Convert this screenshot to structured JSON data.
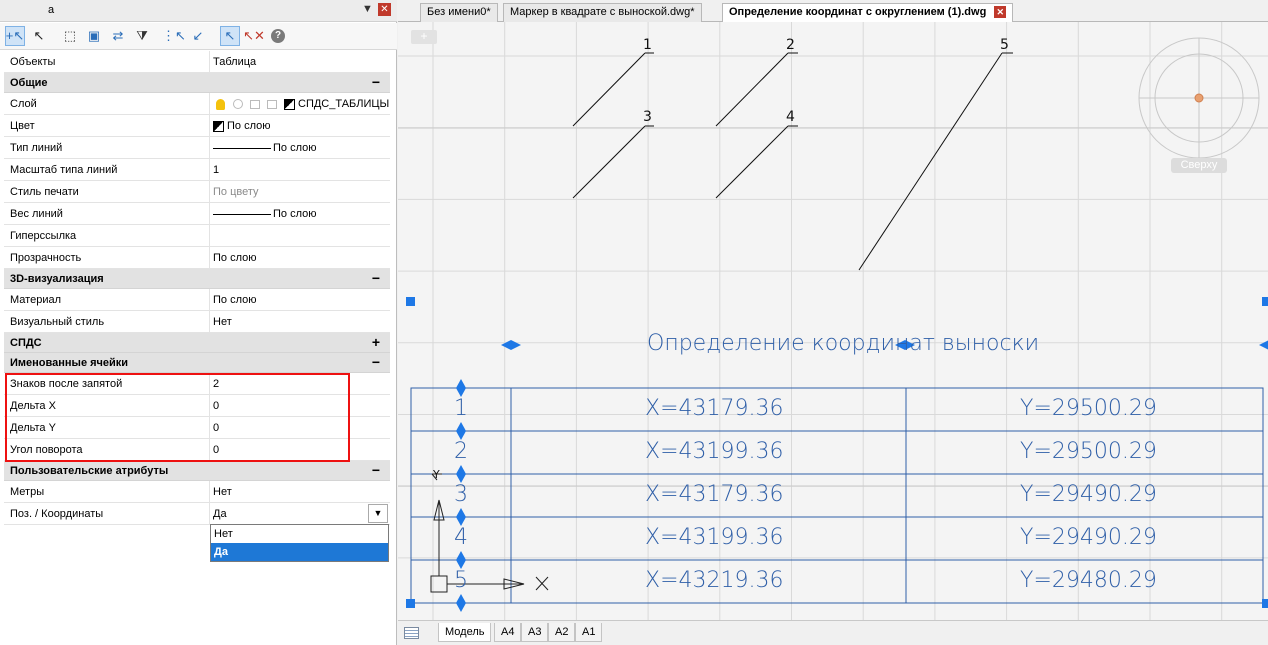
{
  "panel": {
    "title": "a",
    "pin_glyph": "▼",
    "close_glyph": "✕",
    "toolbar": [
      "select-add-icon",
      "pointer-icon",
      "window-select-icon",
      "quick-select-icon",
      "toggle-pickadd-icon",
      "filter-icon",
      "select-similar-icon",
      "deselect-icon",
      "pick-point-icon",
      "deselect-point-icon",
      "help-icon"
    ],
    "help_label": "?",
    "rows": {
      "objects": {
        "k": "Объекты",
        "v": "Таблица"
      },
      "cat_general": {
        "k": "Общие",
        "toggle": "−"
      },
      "layer": {
        "k": "Слой",
        "v": "СПДС_ТАБЛИЦЫ"
      },
      "color": {
        "k": "Цвет",
        "v": "По слою"
      },
      "linetype": {
        "k": "Тип линий",
        "v": "По слою"
      },
      "lt_scale": {
        "k": "Масштаб типа линий",
        "v": "1"
      },
      "plot_style": {
        "k": "Стиль печати",
        "v": "По цвету"
      },
      "lineweight": {
        "k": "Вес линий",
        "v": "По слою"
      },
      "hyperlink": {
        "k": "Гиперссылка",
        "v": ""
      },
      "transparency": {
        "k": "Прозрачность",
        "v": "По слою"
      },
      "cat_3d": {
        "k": "3D-визуализация",
        "toggle": "−"
      },
      "material": {
        "k": "Материал",
        "v": "По слою"
      },
      "visual_style": {
        "k": "Визуальный стиль",
        "v": "Нет"
      },
      "cat_spds": {
        "k": "СПДС",
        "toggle": "+"
      },
      "cat_named": {
        "k": "Именованные ячейки",
        "toggle": "−"
      },
      "decimals": {
        "k": "Знаков после запятой",
        "v": "2"
      },
      "delta_x": {
        "k": "Дельта X",
        "v": "0"
      },
      "delta_y": {
        "k": "Дельта Y",
        "v": "0"
      },
      "rotation": {
        "k": "Угол поворота",
        "v": "0"
      },
      "cat_user": {
        "k": "Пользовательские атрибуты",
        "toggle": "−"
      },
      "meters": {
        "k": "Метры",
        "v": "Нет"
      },
      "pos_coords": {
        "k": "Поз. / Координаты",
        "v": "Да"
      }
    },
    "dropdown": {
      "arrow": "▼",
      "options": [
        "Нет",
        "Да"
      ],
      "selected": "Да"
    }
  },
  "tabs": [
    {
      "label": "Без имени0*",
      "active": false
    },
    {
      "label": "Маркер в квадрате с выноской.dwg*",
      "active": false
    },
    {
      "label": "Определение координат с округлением (1).dwg",
      "active": true
    }
  ],
  "tab_close_glyph": "✕",
  "canvas": {
    "plus_label": "+",
    "viewcube_label": "Сверху",
    "leader_numbers": [
      "1",
      "2",
      "3",
      "4",
      "5"
    ],
    "table_title": "Определение координат выноски",
    "table_rows": [
      {
        "n": "1",
        "x": "X=43179.36",
        "y": "Y=29500.29"
      },
      {
        "n": "2",
        "x": "X=43199.36",
        "y": "Y=29500.29"
      },
      {
        "n": "3",
        "x": "X=43179.36",
        "y": "Y=29490.29"
      },
      {
        "n": "4",
        "x": "X=43199.36",
        "y": "Y=29490.29"
      },
      {
        "n": "5",
        "x": "X=43219.36",
        "y": "Y=29480.29"
      }
    ],
    "ucs_x": "X",
    "ucs_y": "Y",
    "colors": {
      "cad_blue": "#2f5fa8",
      "grip_blue": "#1e78e6",
      "highlight_red": "#e11111",
      "viewcube_center": "#e8a070"
    }
  },
  "status_tabs": [
    "Модель",
    "A4",
    "A3",
    "A2",
    "A1"
  ]
}
